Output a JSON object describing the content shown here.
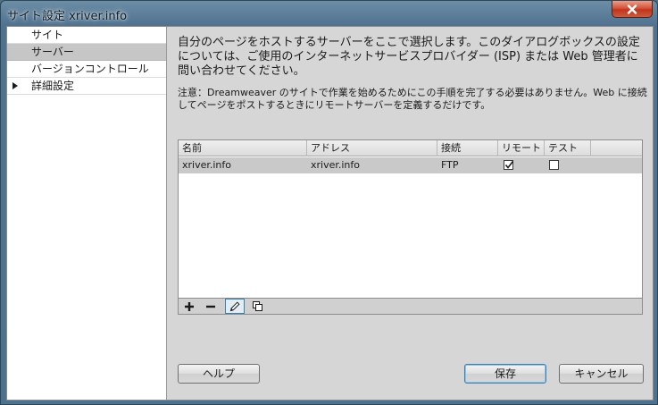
{
  "window": {
    "title": "サイト設定 xriver.info"
  },
  "sidebar": {
    "items": [
      {
        "label": "サイト",
        "selected": false,
        "expandable": false
      },
      {
        "label": "サーバー",
        "selected": true,
        "expandable": false
      },
      {
        "label": "バージョンコントロール",
        "selected": false,
        "expandable": false
      },
      {
        "label": "詳細設定",
        "selected": false,
        "expandable": true
      }
    ]
  },
  "main": {
    "description": "自分のページをホストするサーバーをここで選択します。このダイアログボックスの設定については、ご使用のインターネットサービスプロバイダー (ISP) または Web 管理者に問い合わせてください。",
    "note": "注意：Dreamweaver のサイトで作業を始めるためにこの手順を完了する必要はありません。Web に接続してページをポストするときにリモートサーバーを定義するだけです。",
    "table": {
      "columns": [
        "名前",
        "アドレス",
        "接続",
        "リモート",
        "テスト"
      ],
      "rows": [
        {
          "name": "xriver.info",
          "address": "xriver.info",
          "connection": "FTP",
          "remote": true,
          "test": false
        }
      ]
    },
    "toolbar": {
      "add": "add-server",
      "remove": "remove-server",
      "edit": "edit-server",
      "duplicate": "duplicate-server"
    }
  },
  "buttons": {
    "help": "ヘルプ",
    "save": "保存",
    "cancel": "キャンセル"
  },
  "colors": {
    "selection": "#c6c6c6",
    "focus_border": "#3c7fb1",
    "close_red": "#c0351c"
  }
}
